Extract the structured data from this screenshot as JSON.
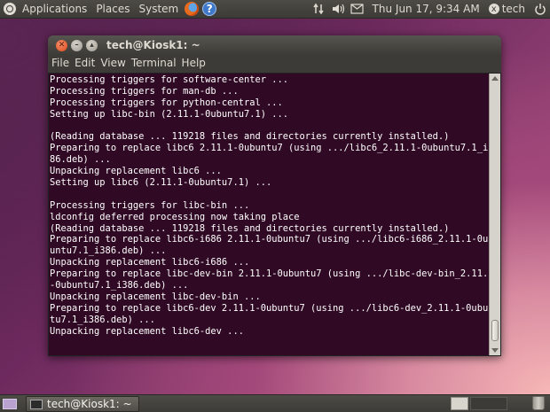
{
  "top_panel": {
    "menus": [
      "Applications",
      "Places",
      "System"
    ],
    "launchers": [
      "firefox-icon",
      "help-icon"
    ],
    "help_glyph": "?",
    "clock": "Thu Jun 17,  9:34 AM",
    "user": "tech",
    "user_glyph": "x",
    "tray_icons": [
      "network-icon",
      "volume-icon",
      "mail-icon",
      "power-icon"
    ]
  },
  "window": {
    "title": "tech@Kiosk1: ~",
    "menus": [
      {
        "label": "File"
      },
      {
        "label": "Edit"
      },
      {
        "label": "View"
      },
      {
        "label": "Terminal"
      },
      {
        "label": "Help"
      }
    ]
  },
  "terminal": {
    "lines": [
      "Processing triggers for software-center ...",
      "Processing triggers for man-db ...",
      "Processing triggers for python-central ...",
      "Setting up libc-bin (2.11.1-0ubuntu7.1) ...",
      "",
      "(Reading database ... 119218 files and directories currently installed.)",
      "Preparing to replace libc6 2.11.1-0ubuntu7 (using .../libc6_2.11.1-0ubuntu7.1_i3",
      "86.deb) ...",
      "Unpacking replacement libc6 ...",
      "Setting up libc6 (2.11.1-0ubuntu7.1) ...",
      "",
      "Processing triggers for libc-bin ...",
      "ldconfig deferred processing now taking place",
      "(Reading database ... 119218 files and directories currently installed.)",
      "Preparing to replace libc6-i686 2.11.1-0ubuntu7 (using .../libc6-i686_2.11.1-0ub",
      "untu7.1_i386.deb) ...",
      "Unpacking replacement libc6-i686 ...",
      "Preparing to replace libc-dev-bin 2.11.1-0ubuntu7 (using .../libc-dev-bin_2.11.1",
      "-0ubuntu7.1_i386.deb) ...",
      "Unpacking replacement libc-dev-bin ...",
      "Preparing to replace libc6-dev 2.11.1-0ubuntu7 (using .../libc6-dev_2.11.1-0ubun",
      "tu7.1_i386.deb) ...",
      "Unpacking replacement libc6-dev ..."
    ]
  },
  "bottom_panel": {
    "task_title": "tech@Kiosk1: ~"
  },
  "colors": {
    "terminal_bg": "#300a24",
    "terminal_fg": "#ffffff",
    "panel_bg": "#3c3b37",
    "close_button": "#df4a16"
  }
}
